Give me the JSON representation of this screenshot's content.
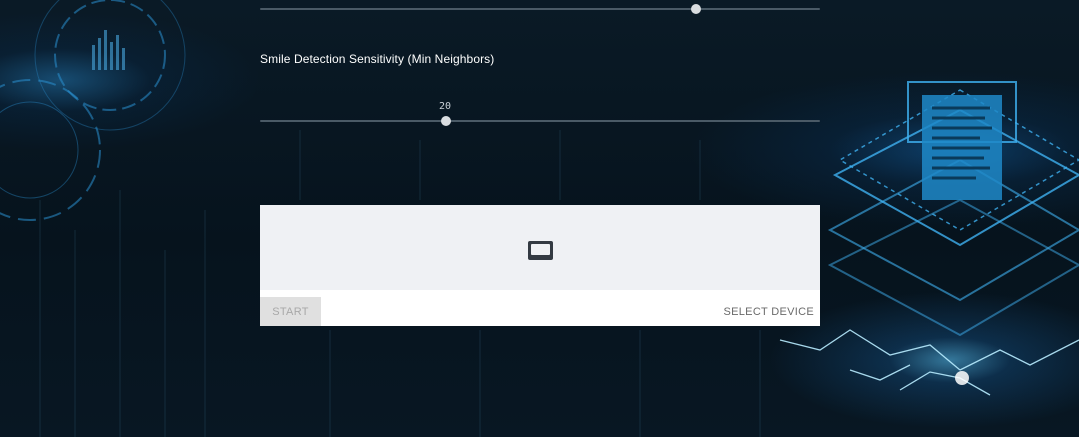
{
  "slider_top": {
    "level": 0.78
  },
  "smile_slider": {
    "label": "Smile Detection Sensitivity (Min Neighbors)",
    "value": "20",
    "level": 0.33
  },
  "webcam": {
    "start_label": "START",
    "select_device_label": "SELECT DEVICE",
    "preview_icon": "webcam-preview-icon"
  },
  "colors": {
    "panel_bg": "#ffffff",
    "preview_bg": "#eff1f4",
    "slider_track": "#4a5a66",
    "slider_thumb": "#d9dde0"
  }
}
